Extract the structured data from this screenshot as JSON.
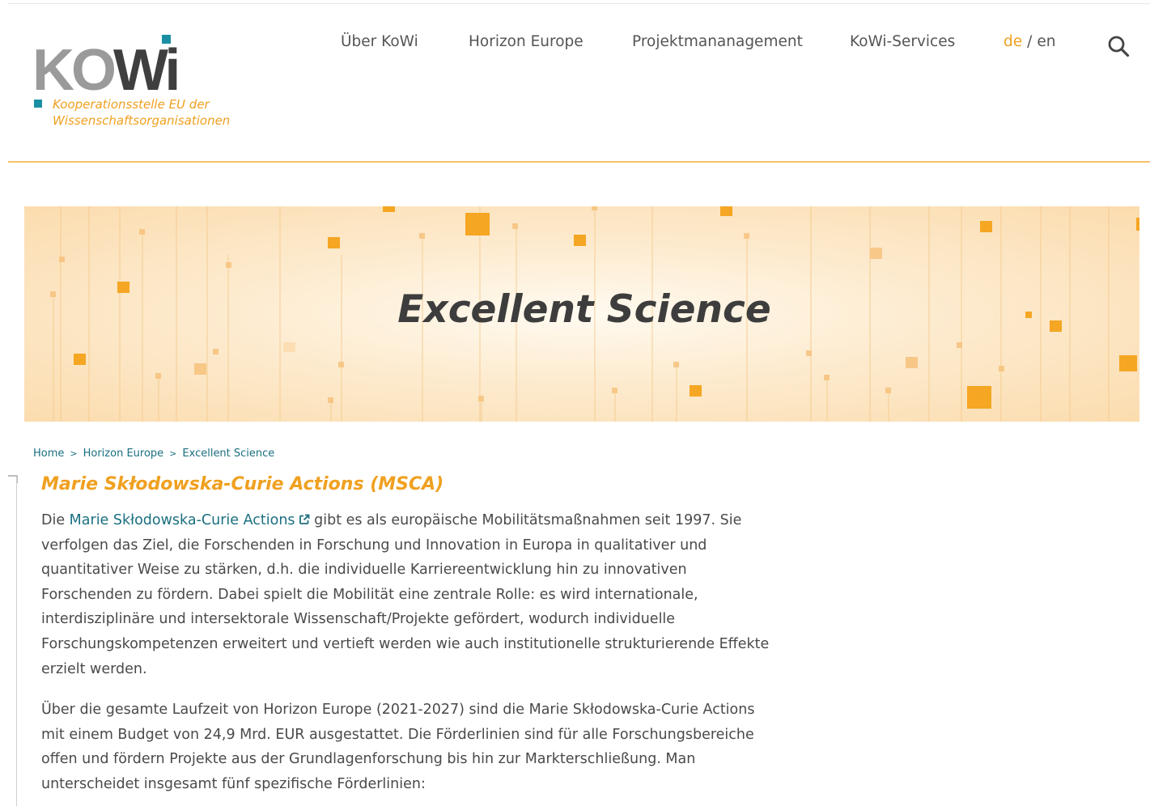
{
  "logo": {
    "ko": "KO",
    "wi": "Wi",
    "tagline_line1": "Kooperationsstelle EU der",
    "tagline_line2": "Wissenschaftsorganisationen"
  },
  "nav": {
    "items": [
      {
        "label": "Über KoWi"
      },
      {
        "label": "Horizon Europe"
      },
      {
        "label": "Projektmananagement"
      },
      {
        "label": "KoWi-Services"
      }
    ],
    "lang_de": "de",
    "lang_sep": "/",
    "lang_en": "en",
    "search_icon": "search-icon"
  },
  "banner": {
    "title": "Excellent Science"
  },
  "breadcrumb": {
    "items": [
      {
        "label": "Home"
      },
      {
        "label": "Horizon Europe"
      },
      {
        "label": "Excellent Science"
      }
    ],
    "separator": ">"
  },
  "main": {
    "title": "Marie Skłodowska-Curie Actions (MSCA)",
    "para1_prefix": "Die ",
    "para1_link": "Marie Skłodowska-Curie Actions",
    "para1_rest": " gibt es als europäische Mobilitätsmaßnahmen seit 1997. Sie verfolgen das Ziel, die Forschenden in Forschung und Innovation in Europa in qualitativer und quantitativer Weise zu stärken, d.h. die individuelle Karriereentwicklung hin zu innovativen Forschenden zu fördern. Dabei spielt die Mobilität eine zentrale Rolle: es wird internationale, interdisziplinäre und intersektorale Wissenschaft/Projekte gefördert, wodurch individuelle Forschungskompetenzen erweitert und vertieft werden wie auch institutionelle strukturierende Effekte erzielt werden.",
    "para2": "Über die gesamte Laufzeit von Horizon Europe (2021-2027) sind die Marie Skłodowska-Curie Actions mit einem Budget von 24,9 Mrd. EUR ausgestattet. Die Förderlinien sind für alle Forschungsbereiche offen und fördern Projekte aus der Grundlagenforschung bis hin zur Markterschließung. Man unterscheidet insgesamt fünf spezifische Förderlinien:"
  },
  "colors": {
    "accent_orange": "#f0a020",
    "link_teal": "#1a6f80",
    "logo_teal": "#1a8fa3"
  }
}
